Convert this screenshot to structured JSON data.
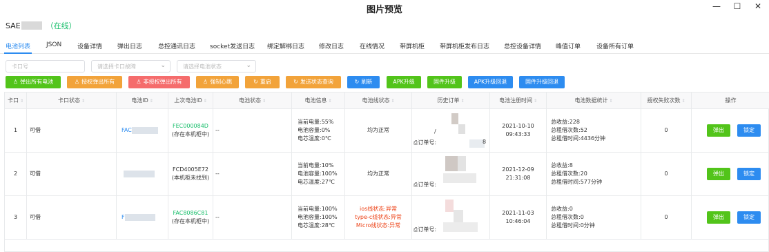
{
  "window": {
    "title": "图片预览"
  },
  "device": {
    "prefix": "SAE",
    "status": "（在线）"
  },
  "tabs": [
    "电池列表",
    "JSON",
    "设备详情",
    "弹出日志",
    "总控通讯日志",
    "socket发送日志",
    "绑定解绑日志",
    "修改日志",
    "在线情况",
    "带屏机柜",
    "带屏机柜发布日志",
    "总控设备详情",
    "峰值订单",
    "设备所有订单"
  ],
  "filters": {
    "slot": "卡口号",
    "slot_fault": "请选择卡口故障",
    "battery_status": "请选择电池状态"
  },
  "buttons": [
    "弹出所有电池",
    "授权弹出所有",
    "非授权弹出所有",
    "强制心跳",
    "重启",
    "发送状态查询",
    "刷新",
    "APK升级",
    "固件升级",
    "APK升级回退",
    "固件升级回退"
  ],
  "columns": [
    "卡口",
    "卡口状态",
    "电池ID",
    "上次电池ID",
    "电池状态",
    "电池信息",
    "电池线状态",
    "历史订单",
    "电池注册时间",
    "电池数据统计",
    "授权失败次数",
    "操作"
  ],
  "rows": [
    {
      "slot": "1",
      "slot_status": "可借",
      "battery_id": "FAC",
      "last_id": "FEC000084D",
      "last_note": "(存在本机柜中)",
      "battery_status": "--",
      "info": [
        "当前电量:55%",
        "电池容量:0%",
        "电芯温度:0℃"
      ],
      "line_status": [
        "均为正常"
      ],
      "order": "订单号:",
      "order_tail": "8",
      "reg_time": "2021-10-10 09:43:33",
      "stats": [
        "总收益:228",
        "总租借次数:52",
        "总租借时间:4436分钟"
      ],
      "auth_fail": "0",
      "eject": "弹出",
      "lock": "锁定"
    },
    {
      "slot": "2",
      "slot_status": "可借",
      "battery_id": "",
      "last_id": "FCD4005E72",
      "last_note": "(本机柜未找到)",
      "battery_status": "--",
      "info": [
        "当前电量:10%",
        "电池容量:100%",
        "电芯温度:27℃"
      ],
      "line_status": [
        "均为正常"
      ],
      "order": "订单号:",
      "order_tail": "",
      "reg_time": "2021-12-09 21:31:08",
      "stats": [
        "总收益:8",
        "总租借次数:20",
        "总租借时间:577分钟"
      ],
      "auth_fail": "0",
      "eject": "弹出",
      "lock": "锁定"
    },
    {
      "slot": "3",
      "slot_status": "可借",
      "battery_id": "F",
      "last_id": "FAC8086C81",
      "last_note": "(存在本机柜中)",
      "battery_status": "--",
      "info": [
        "当前电量:100%",
        "电池容量:100%",
        "电芯温度:28℃"
      ],
      "line_status": [
        "ios线状态:异常",
        "type-c线状态:异常",
        "Micro线状态:异常"
      ],
      "order": "订单号:",
      "order_tail": "",
      "reg_time": "2021-11-03 10:46:04",
      "stats": [
        "总收益:0",
        "总租借次数:0",
        "总租借时间:0分钟"
      ],
      "auth_fail": "0",
      "eject": "弹出",
      "lock": "锁定"
    }
  ]
}
